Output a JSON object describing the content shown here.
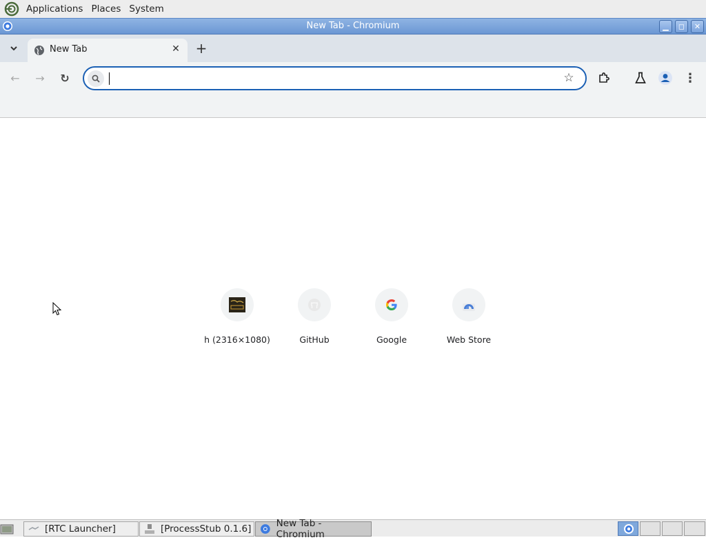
{
  "desktop": {
    "menus": [
      "Applications",
      "Places",
      "System"
    ]
  },
  "window": {
    "title": "New Tab - Chromium"
  },
  "browser": {
    "tab": {
      "label": "New Tab",
      "close": "✕"
    },
    "new_tab_glyph": "+",
    "tab_search_glyph": "⌄",
    "nav": {
      "back": "←",
      "forward": "→",
      "reload": "↻"
    },
    "omnibox": {
      "value": "",
      "placeholder": ""
    },
    "star_glyph": "☆",
    "menu_glyph": "⋮"
  },
  "new_tab_page": {
    "shortcuts": [
      {
        "label": "h (2316×1080)",
        "icon": "thumbnail-icon"
      },
      {
        "label": "GitHub",
        "icon": "github-icon"
      },
      {
        "label": "Google",
        "icon": "google-icon"
      },
      {
        "label": "Web Store",
        "icon": "web-store-icon"
      }
    ]
  },
  "taskbar": {
    "items": [
      {
        "label": "[RTC Launcher]",
        "icon": "launcher-icon",
        "active": false
      },
      {
        "label": "[ProcessStub 0.1.6]",
        "icon": "process-icon",
        "active": false
      },
      {
        "label": "New Tab - Chromium",
        "icon": "chromium-icon",
        "active": true
      }
    ]
  },
  "colors": {
    "accent": "#1a5fb4",
    "titlebar": "#6b97d4",
    "tabstrip": "#dde3ea",
    "toolbar": "#f1f3f4"
  }
}
